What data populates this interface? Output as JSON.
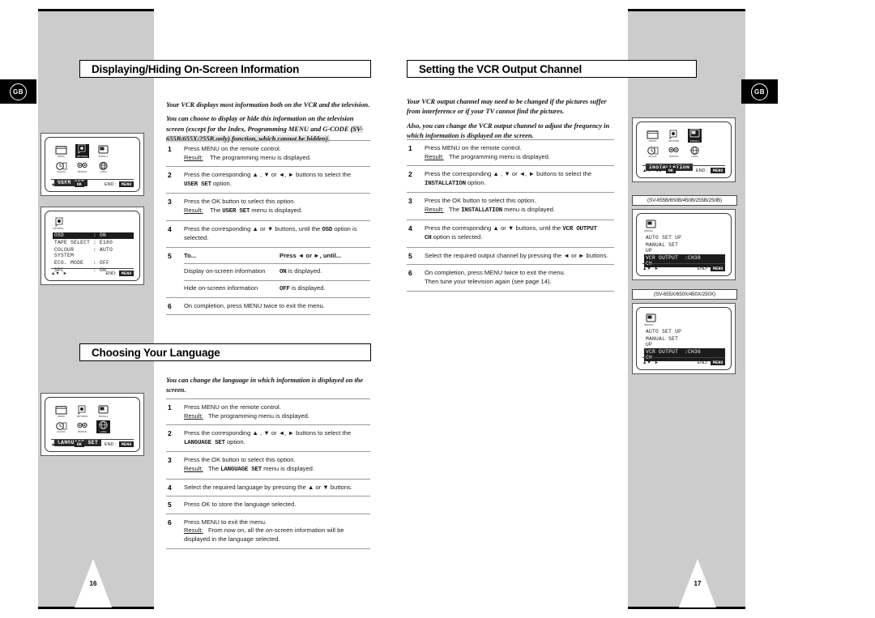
{
  "document": {
    "locale_badge": "GB",
    "left_page_number": "16",
    "right_page_number": "17"
  },
  "left_page": {
    "sections": [
      {
        "title": "Displaying/Hiding On-Screen Information",
        "intro": [
          "Your VCR displays most information both on the VCR and the television.",
          "You can choose to display or hide this information on the television screen (except for the Index, Programming MENU and G-CODE",
          "(SV-655B/655X/255B only) function, which cannot be hidden)."
        ],
        "steps": [
          {
            "num": "1",
            "line1": "Press MENU on the remote control.",
            "result_label": "Result:",
            "result_text": "The programming menu is displayed."
          },
          {
            "num": "2",
            "line1": "Press the corresponding ▲ , ▼ or ◄, ► buttons to select the",
            "line2_mono": "USER SET",
            "line2_tail": " option."
          },
          {
            "num": "3",
            "line1": "Press the OK button to select this option.",
            "result_label": "Result:",
            "result_pre": "The ",
            "result_mono": "USER SET",
            "result_post": " menu is displayed."
          },
          {
            "num": "4",
            "line1_pre": "Press the corresponding ▲ or ▼ buttons, until the ",
            "line1_mono": "OSD",
            "line1_post": " option is selected."
          },
          {
            "num": "5",
            "table": {
              "header_left": "To...",
              "header_right": "Press ◄ or ►, until...",
              "rows": [
                {
                  "left": "Display on-screen information",
                  "right_mono": "ON",
                  "right_tail": " is displayed."
                },
                {
                  "left": "Hide on-screen information",
                  "right_mono": "OFF",
                  "right_tail": " is displayed."
                }
              ]
            }
          },
          {
            "num": "6",
            "line1": "On completion, press MENU twice to exit the menu."
          }
        ],
        "screens": [
          {
            "type": "icon-menu",
            "icons": [
              {
                "label": "PROG",
                "glyph": "calendar-icon",
                "selected": false
              },
              {
                "label": "OPTIONS",
                "glyph": "options-icon",
                "selected": true
              },
              {
                "label": "INSTALL",
                "glyph": "install-icon",
                "selected": false
              },
              {
                "label": "CLOCK",
                "glyph": "clock-icon",
                "selected": false
              },
              {
                "label": "BONUS",
                "glyph": "bonus-icon",
                "selected": false
              },
              {
                "label": "LANG",
                "glyph": "globe-icon",
                "selected": false
              }
            ],
            "menu_name": "USER SET",
            "footer_keys": "OK",
            "footer_end_label": "END :",
            "footer_end_key": "MENU"
          },
          {
            "type": "list-menu",
            "header_icon": "options-icon",
            "rows": [
              {
                "label": "OSD",
                "value": ": ON",
                "highlight": true
              },
              {
                "label": "TAPE SELECT",
                "value": ": E180",
                "highlight": false
              },
              {
                "label": "COLOUR SYSTEM",
                "value": ": AUTO",
                "highlight": false
              },
              {
                "label": "ECO. MODE",
                "value": ": OFF",
                "highlight": false
              },
              {
                "label": "SPC",
                "value": ": ON",
                "highlight": false
              }
            ],
            "footer_end_label": "END:",
            "footer_end_key": "MENU"
          }
        ]
      },
      {
        "title": "Choosing Your Language",
        "intro": [
          "You can change the language in which information is displayed on the screen."
        ],
        "steps": [
          {
            "num": "1",
            "line1": "Press MENU on the remote control.",
            "result_label": "Result:",
            "result_text": "The programming menu is displayed."
          },
          {
            "num": "2",
            "line1": "Press the corresponding ▲ , ▼ or ◄, ► buttons to select the",
            "line2_mono": "LANGUAGE SET",
            "line2_tail": " option."
          },
          {
            "num": "3",
            "line1": "Press the OK button to select this option.",
            "result_label": "Result:",
            "result_pre": "The ",
            "result_mono": "LANGUAGE SET",
            "result_post": " menu is displayed."
          },
          {
            "num": "4",
            "line1": "Select the required language by pressing the ▲ or ▼ buttons."
          },
          {
            "num": "5",
            "line1": "Press OK to store the language selected."
          },
          {
            "num": "6",
            "line1": "Press MENU to exit the menu.",
            "result_label": "Result:",
            "result_text": "From now on, all the on-screen information will be displayed in the language selected."
          }
        ],
        "screens": [
          {
            "type": "icon-menu",
            "icons": [
              {
                "label": "PROG",
                "glyph": "calendar-icon",
                "selected": false
              },
              {
                "label": "OPTIONS",
                "glyph": "options-icon",
                "selected": false
              },
              {
                "label": "INSTALL",
                "glyph": "install-icon",
                "selected": false
              },
              {
                "label": "CLOCK",
                "glyph": "clock-icon",
                "selected": false
              },
              {
                "label": "BONUS",
                "glyph": "bonus-icon",
                "selected": false
              },
              {
                "label": "LANG",
                "glyph": "globe-icon",
                "selected": true
              }
            ],
            "menu_name": "LANGUAGE SET",
            "footer_keys": "OK",
            "footer_end_label": "END :",
            "footer_end_key": "MENU"
          }
        ]
      }
    ]
  },
  "right_page": {
    "sections": [
      {
        "title": "Setting the VCR Output Channel",
        "intro": [
          "Your VCR output channel may need to be changed if the pictures suffer from interference or if your TV cannot find the pictures.",
          "Also, you can change the VCR output channel to adjust the frequency in which information is displayed on the screen."
        ],
        "steps": [
          {
            "num": "1",
            "line1": "Press MENU on the remote control.",
            "result_label": "Result:",
            "result_text": "The programming menu is displayed."
          },
          {
            "num": "2",
            "line1": "Press the corresponding ▲ , ▼ or ◄, ► buttons to select the",
            "line2_mono": "INSTALLATION",
            "line2_tail": " option."
          },
          {
            "num": "3",
            "line1": "Press the OK button to select this option.",
            "result_label": "Result:",
            "result_pre": "The ",
            "result_mono": "INSTALLATION",
            "result_post": " menu is displayed."
          },
          {
            "num": "4",
            "line1_pre": "Press the corresponding ▲ or ▼ buttons, until the ",
            "line1_mono": "VCR OUTPUT",
            "line1_post": "",
            "line2_mono": "CH",
            "line2_tail": " option is selected."
          },
          {
            "num": "5",
            "line1": "Select the required output channel by pressing the ◄ or ► buttons."
          },
          {
            "num": "6",
            "line1": "On completion, press MENU twice to exit the menu.",
            "line2": "Then tune your television again (see page 14)."
          }
        ],
        "screens": [
          {
            "type": "icon-menu",
            "icons": [
              {
                "label": "PROG",
                "glyph": "calendar-icon",
                "selected": false
              },
              {
                "label": "OPTIONS",
                "glyph": "options-icon",
                "selected": false
              },
              {
                "label": "INSTALL",
                "glyph": "install-icon",
                "selected": true
              },
              {
                "label": "CLOCK",
                "glyph": "clock-icon",
                "selected": false
              },
              {
                "label": "BONUS",
                "glyph": "bonus-icon",
                "selected": false
              },
              {
                "label": "LANG",
                "glyph": "globe-icon",
                "selected": false
              }
            ],
            "menu_name": "INSTALLATION",
            "footer_keys": "OK",
            "footer_end_label": "END :",
            "footer_end_key": "MENU"
          },
          {
            "type": "model-tag",
            "text": "(SV-655B/650B/450B/255B/250B)"
          },
          {
            "type": "list-menu",
            "header_icon": "install-icon",
            "rows": [
              {
                "label": "AUTO SET UP",
                "value": "",
                "highlight": false
              },
              {
                "label": "MANUAL SET UP",
                "value": "",
                "highlight": false
              },
              {
                "label": "VCR OUTPUT CH",
                "value": ":CH38",
                "highlight": true
              }
            ],
            "footer_end_label": "END:",
            "footer_end_key": "MENU"
          },
          {
            "type": "model-tag",
            "text": "(SV-655X/650X/450X/250X)"
          },
          {
            "type": "list-menu",
            "header_icon": "install-icon",
            "rows": [
              {
                "label": "AUTO SET UP",
                "value": "",
                "highlight": false
              },
              {
                "label": "MANUAL SET UP",
                "value": "",
                "highlight": false
              },
              {
                "label": "VCR OUTPUT CH",
                "value": ":CH36",
                "highlight": true
              }
            ],
            "footer_end_label": "END:",
            "footer_end_key": "MENU"
          }
        ]
      }
    ]
  }
}
